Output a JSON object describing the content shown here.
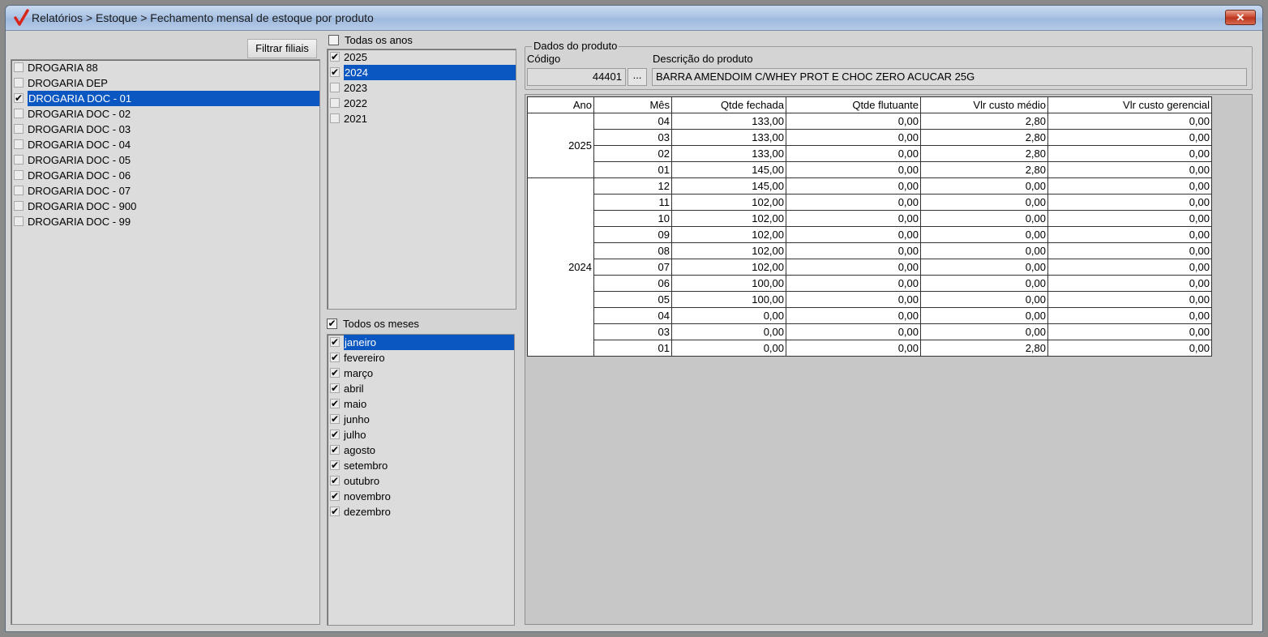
{
  "window": {
    "title": "Relatórios > Estoque > Fechamento mensal de estoque por produto",
    "close_label": "✕"
  },
  "branches": {
    "filter_label": "Filtrar filiais",
    "items": [
      {
        "label": "DROGARIA 88",
        "checked": false,
        "selected": false
      },
      {
        "label": "DROGARIA DEP",
        "checked": false,
        "selected": false
      },
      {
        "label": "DROGARIA DOC - 01",
        "checked": true,
        "selected": true
      },
      {
        "label": "DROGARIA DOC - 02",
        "checked": false,
        "selected": false
      },
      {
        "label": "DROGARIA DOC - 03",
        "checked": false,
        "selected": false
      },
      {
        "label": "DROGARIA DOC - 04",
        "checked": false,
        "selected": false
      },
      {
        "label": "DROGARIA DOC - 05",
        "checked": false,
        "selected": false
      },
      {
        "label": "DROGARIA DOC - 06",
        "checked": false,
        "selected": false
      },
      {
        "label": "DROGARIA DOC - 07",
        "checked": false,
        "selected": false
      },
      {
        "label": "DROGARIA DOC - 900",
        "checked": false,
        "selected": false
      },
      {
        "label": "DROGARIA DOC - 99",
        "checked": false,
        "selected": false
      }
    ]
  },
  "years": {
    "all_label": "Todas os anos",
    "all_checked": false,
    "items": [
      {
        "label": "2025",
        "checked": true,
        "selected": false
      },
      {
        "label": "2024",
        "checked": true,
        "selected": true
      },
      {
        "label": "2023",
        "checked": false,
        "selected": false
      },
      {
        "label": "2022",
        "checked": false,
        "selected": false
      },
      {
        "label": "2021",
        "checked": false,
        "selected": false
      }
    ]
  },
  "months": {
    "all_label": "Todos os meses",
    "all_checked": true,
    "items": [
      {
        "label": "janeiro",
        "checked": true,
        "selected": true
      },
      {
        "label": "fevereiro",
        "checked": true,
        "selected": false
      },
      {
        "label": "março",
        "checked": true,
        "selected": false
      },
      {
        "label": "abril",
        "checked": true,
        "selected": false
      },
      {
        "label": "maio",
        "checked": true,
        "selected": false
      },
      {
        "label": "junho",
        "checked": true,
        "selected": false
      },
      {
        "label": "julho",
        "checked": true,
        "selected": false
      },
      {
        "label": "agosto",
        "checked": true,
        "selected": false
      },
      {
        "label": "setembro",
        "checked": true,
        "selected": false
      },
      {
        "label": "outubro",
        "checked": true,
        "selected": false
      },
      {
        "label": "novembro",
        "checked": true,
        "selected": false
      },
      {
        "label": "dezembro",
        "checked": true,
        "selected": false
      }
    ]
  },
  "product": {
    "group_label": "Dados do produto",
    "code_label": "Código",
    "code_value": "44401",
    "lookup_label": "...",
    "description_label": "Descrição do produto",
    "description_value": "BARRA AMENDOIM C/WHEY PROT E CHOC ZERO ACUCAR 25G"
  },
  "grid": {
    "columns": [
      "Ano",
      "Mês",
      "Qtde fechada",
      "Qtde flutuante",
      "Vlr custo médio",
      "Vlr custo gerencial"
    ],
    "groups": [
      {
        "year": "2025",
        "rows": [
          [
            "04",
            "133,00",
            "0,00",
            "2,80",
            "0,00"
          ],
          [
            "03",
            "133,00",
            "0,00",
            "2,80",
            "0,00"
          ],
          [
            "02",
            "133,00",
            "0,00",
            "2,80",
            "0,00"
          ],
          [
            "01",
            "145,00",
            "0,00",
            "2,80",
            "0,00"
          ]
        ]
      },
      {
        "year": "2024",
        "rows": [
          [
            "12",
            "145,00",
            "0,00",
            "0,00",
            "0,00"
          ],
          [
            "11",
            "102,00",
            "0,00",
            "0,00",
            "0,00"
          ],
          [
            "10",
            "102,00",
            "0,00",
            "0,00",
            "0,00"
          ],
          [
            "09",
            "102,00",
            "0,00",
            "0,00",
            "0,00"
          ],
          [
            "08",
            "102,00",
            "0,00",
            "0,00",
            "0,00"
          ],
          [
            "07",
            "102,00",
            "0,00",
            "0,00",
            "0,00"
          ],
          [
            "06",
            "100,00",
            "0,00",
            "0,00",
            "0,00"
          ],
          [
            "05",
            "100,00",
            "0,00",
            "0,00",
            "0,00"
          ],
          [
            "04",
            "0,00",
            "0,00",
            "0,00",
            "0,00"
          ],
          [
            "03",
            "0,00",
            "0,00",
            "0,00",
            "0,00"
          ],
          [
            "01",
            "0,00",
            "0,00",
            "2,80",
            "0,00"
          ]
        ]
      }
    ]
  }
}
